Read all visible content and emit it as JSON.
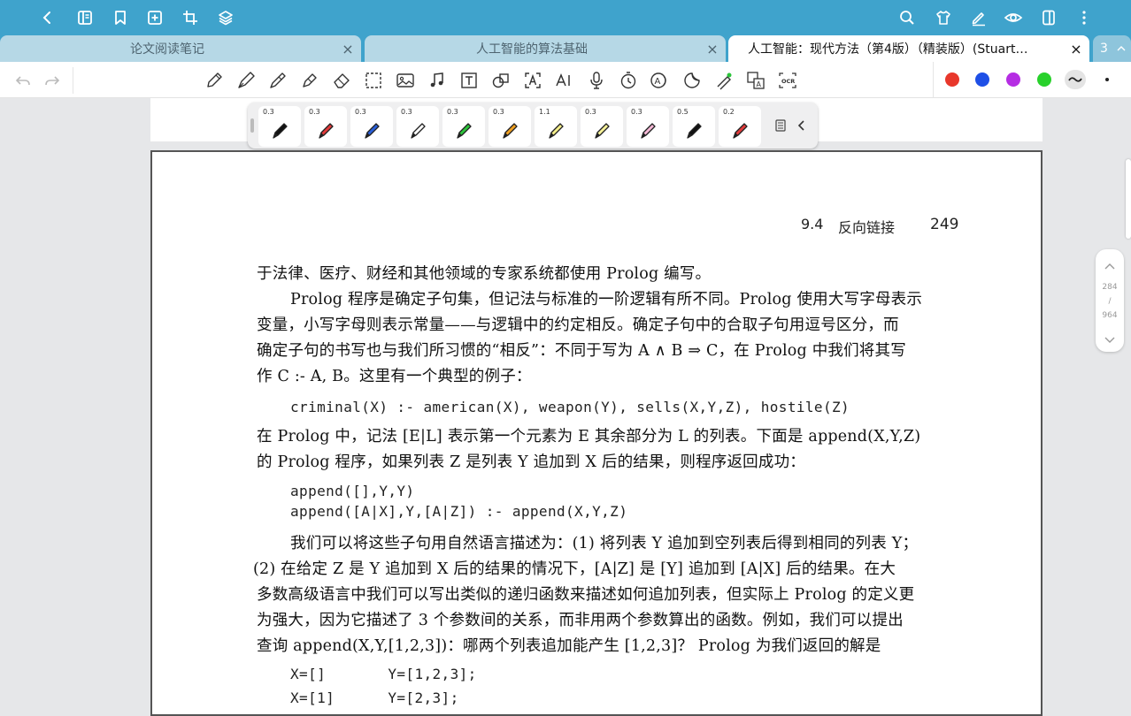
{
  "tabs": [
    {
      "label": "论文阅读笔记",
      "close": "×"
    },
    {
      "label": "人工智能的算法基础",
      "close": "×"
    },
    {
      "label": "人工智能：现代方法（第4版）（精装版）(Stuart…",
      "close": "×"
    },
    {
      "label": "3"
    }
  ],
  "toolbar": {
    "colors": [
      "#e8372b",
      "#1e4fe6",
      "#b52de3",
      "#28d12b"
    ]
  },
  "pens": [
    {
      "size": "0.3",
      "color": "#111111"
    },
    {
      "size": "0.3",
      "color": "#e23a3a"
    },
    {
      "size": "0.3",
      "color": "#2a5fd9"
    },
    {
      "size": "0.3",
      "color": "#ffffff"
    },
    {
      "size": "0.3",
      "color": "#2bc43a"
    },
    {
      "size": "0.3",
      "color": "#f0a020"
    },
    {
      "size": "1.1",
      "color": "#f4ee8a"
    },
    {
      "size": "0.3",
      "color": "#f6f199"
    },
    {
      "size": "0.3",
      "color": "#f5b8d6"
    },
    {
      "size": "0.5",
      "color": "#111111"
    },
    {
      "size": "0.2",
      "color": "#e23a3a"
    }
  ],
  "page": {
    "section": "9.4",
    "section_title": "反向链接",
    "page_number": "249",
    "lines": [
      "于法律、医疗、财经和其他领域的专家系统都使用 Prolog 编写。",
      "Prolog 程序是确定子句集，但记法与标准的一阶逻辑有所不同。Prolog 使用大写字母表示",
      "变量，小写字母则表示常量——与逻辑中的约定相反。确定子句中的合取子句用逗号区分，而",
      "确定子句的书写也与我们所习惯的“相反”：不同于写为 A ∧ B ⇒ C，在 Prolog 中我们将其写",
      "作 C :- A, B。这里有一个典型的例子：",
      "criminal(X) :- american(X), weapon(Y), sells(X,Y,Z), hostile(Z)",
      "在 Prolog 中，记法 [E|L] 表示第一个元素为 E 其余部分为 L 的列表。下面是 append(X,Y,Z)",
      "的 Prolog 程序，如果列表 Z 是列表 Y 追加到 X 后的结果，则程序返回成功：",
      "append([],Y,Y)",
      "append([A|X],Y,[A|Z]) :- append(X,Y,Z)",
      "我们可以将这些子句用自然语言描述为：(1) 将列表 Y 追加到空列表后得到相同的列表 Y；",
      "(2) 在给定 Z 是 Y 追加到 X 后的结果的情况下，[A|Z] 是 [Y] 追加到 [A|X] 后的结果。在大",
      "多数高级语言中我们可以写出类似的递归函数来描述如何追加列表，但实际上 Prolog 的定义更",
      "为强大，因为它描述了 3 个参数间的关系，而非用两个参数算出的函数。例如，我们可以提出",
      "查询 append(X,Y,[1,2,3])：哪两个列表追加能产生 [1,2,3]？ Prolog 为我们返回的解是",
      "X=[]       Y=[1,2,3];",
      "X=[1]      Y=[2,3];"
    ]
  },
  "scroller": {
    "current": "284",
    "sep": "/",
    "total": "964"
  }
}
